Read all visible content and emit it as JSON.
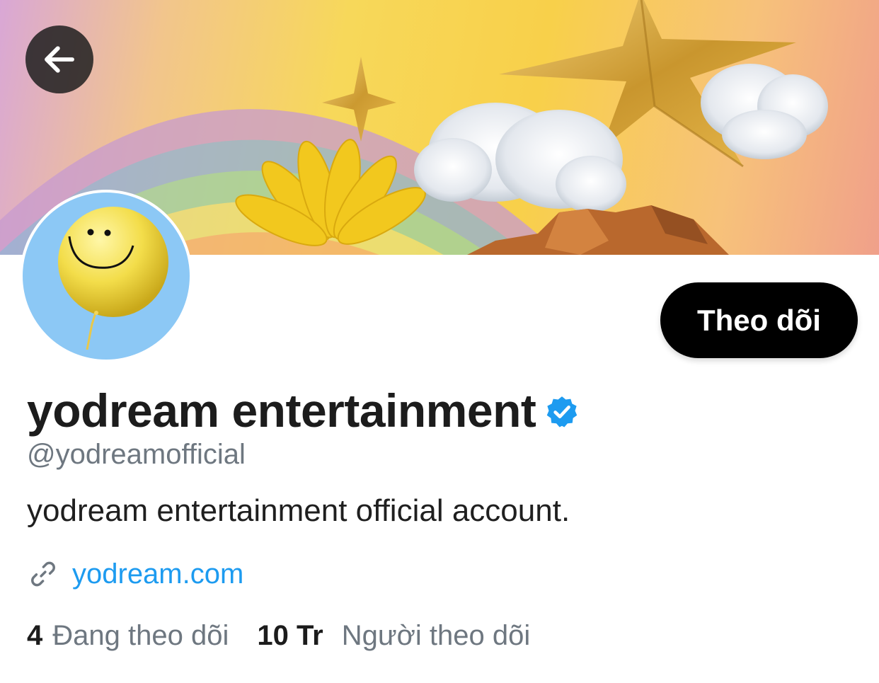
{
  "header": {
    "back_icon": "arrow-left-icon",
    "banner_description_icon": "banner-image"
  },
  "profile": {
    "display_name": "yodream entertainment",
    "verified_icon": "verified-badge-icon",
    "verified_color": "#1d9bf0",
    "handle": "@yodreamofficial",
    "bio": "yodream entertainment official account.",
    "link_icon": "link-icon",
    "website": "yodream.com",
    "follow_button_label": "Theo dõi"
  },
  "stats": {
    "following_count": "4",
    "following_label": "Đang theo dõi",
    "followers_count": "10 Tr",
    "followers_label": "Người theo dõi"
  },
  "colors": {
    "accent": "#1d9bf0",
    "secondary_text": "#6e7780",
    "avatar_bg": "#8cc8f5"
  }
}
